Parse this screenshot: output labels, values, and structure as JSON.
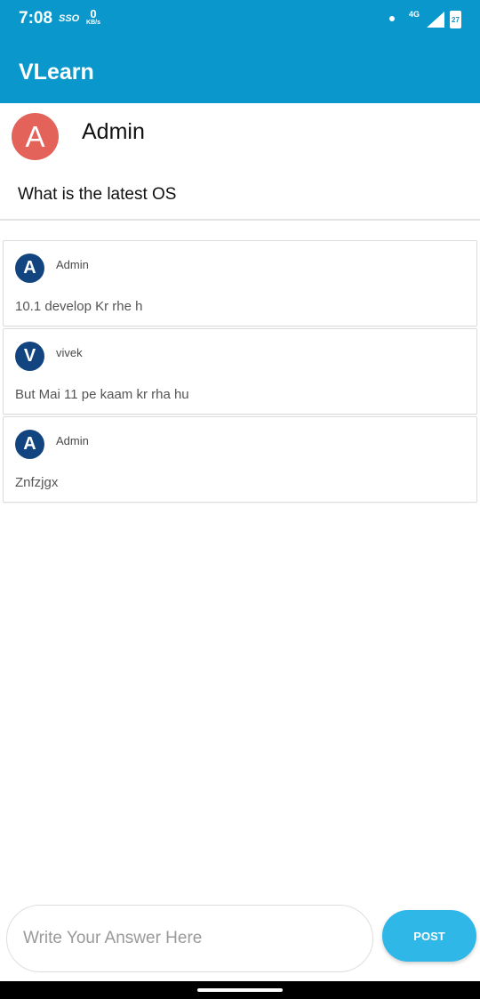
{
  "status_bar": {
    "time": "7:08",
    "sso": "SSO",
    "speed_value": "0",
    "speed_unit": "KB/s",
    "network": "4G",
    "battery": "27"
  },
  "app": {
    "title": "VLearn"
  },
  "question": {
    "avatar_letter": "A",
    "author": "Admin",
    "text": "What is the latest OS"
  },
  "answers": [
    {
      "avatar_letter": "A",
      "author": "Admin",
      "text": "10.1 develop Kr rhe h"
    },
    {
      "avatar_letter": "V",
      "author": "vivek",
      "text": "But Mai 11 pe kaam kr rha hu"
    },
    {
      "avatar_letter": "A",
      "author": "Admin",
      "text": "Znfzjgx"
    }
  ],
  "composer": {
    "placeholder": "Write Your Answer Here",
    "value": "",
    "post_label": "POST"
  },
  "colors": {
    "app_bar": "#0a98cc",
    "question_avatar": "#e3625a",
    "answer_avatar": "#12457f",
    "post_button": "#2fb7e8"
  },
  "icons": [
    "signal-icon",
    "battery-icon",
    "wifi-dot-icon"
  ]
}
